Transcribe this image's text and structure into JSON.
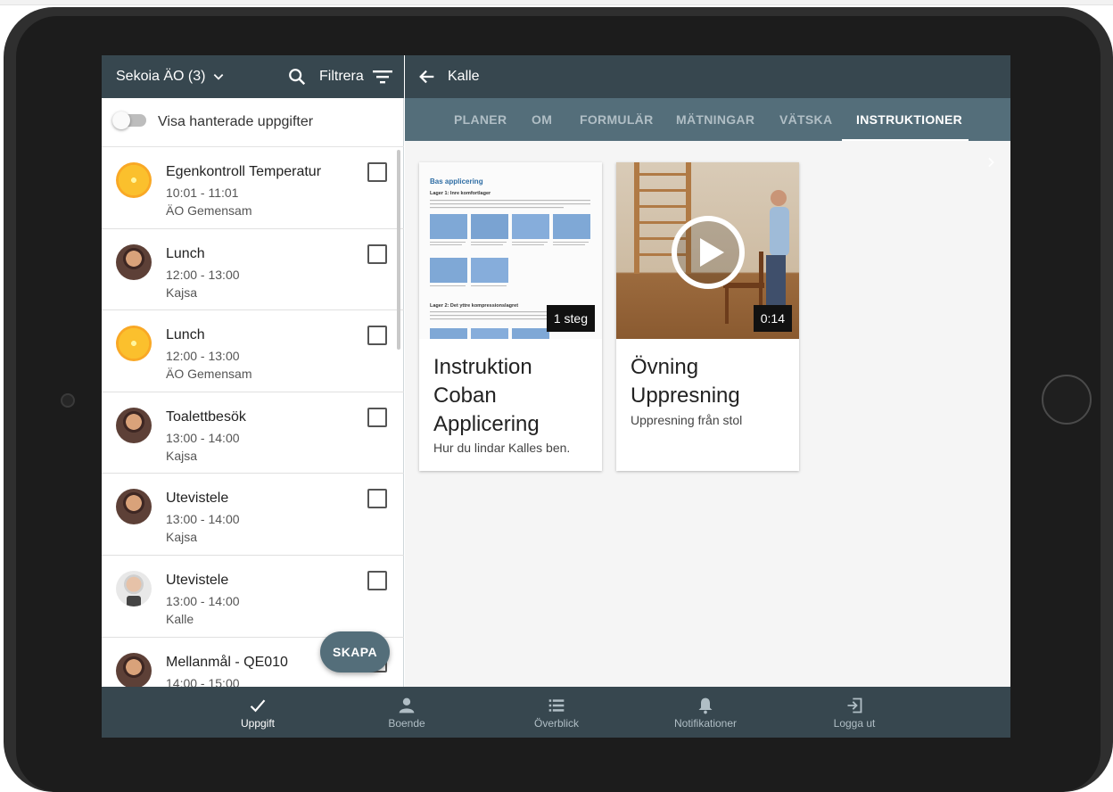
{
  "left_header": {
    "unit": "Sekoia ÄO (3)",
    "filter_label": "Filtrera"
  },
  "toggle": {
    "label": "Visa hanterade uppgifter"
  },
  "tasks": [
    {
      "title": "Egenkontroll Temperatur",
      "time": "10:01 - 11:01",
      "who": "ÄO Gemensam",
      "avatar": "flower-avatar"
    },
    {
      "title": "Lunch",
      "time": "12:00 - 13:00",
      "who": "Kajsa",
      "avatar": "person-avatar"
    },
    {
      "title": "Lunch",
      "time": "12:00 - 13:00",
      "who": "ÄO Gemensam",
      "avatar": "flower-avatar"
    },
    {
      "title": "Toalettbesök",
      "time": "13:00 - 14:00",
      "who": "Kajsa",
      "avatar": "person-avatar"
    },
    {
      "title": "Utevistele",
      "time": "13:00 - 14:00",
      "who": "Kajsa",
      "avatar": "person-avatar"
    },
    {
      "title": "Utevistele",
      "time": "13:00 - 14:00",
      "who": "Kalle",
      "avatar": "person-avatar"
    },
    {
      "title": "Mellanmål - QE010",
      "time": "14:00 - 15:00",
      "who": "",
      "avatar": "person-avatar"
    }
  ],
  "fab": {
    "label": "SKAPA"
  },
  "right_header": {
    "name": "Kalle"
  },
  "tabs": [
    {
      "label": "PLANER",
      "active": false
    },
    {
      "label": "OM",
      "active": false
    },
    {
      "label": "FORMULÄR",
      "active": false
    },
    {
      "label": "MÄTNINGAR",
      "active": false
    },
    {
      "label": "VÄTSKA",
      "active": false
    },
    {
      "label": "INSTRUKTIONER",
      "active": true
    }
  ],
  "cards": [
    {
      "badge": "1 steg",
      "title": "Instruktion Coban Applicering",
      "subtitle": "Hur du lindar Kalles ben.",
      "doc_heading": "Bas applicering",
      "doc_layer1": "Lager 1: Inre komfortlager",
      "doc_layer2": "Lager 2: Det yttre kompressionslagret"
    },
    {
      "badge": "0:14",
      "title": "Övning Uppresning",
      "subtitle": "Uppresning från stol"
    }
  ],
  "bottom_nav": [
    {
      "label": "Uppgift",
      "icon": "check-icon",
      "active": true
    },
    {
      "label": "Boende",
      "icon": "person-icon",
      "active": false
    },
    {
      "label": "Överblick",
      "icon": "list-icon",
      "active": false
    },
    {
      "label": "Notifikationer",
      "icon": "bell-icon",
      "active": false
    },
    {
      "label": "Logga ut",
      "icon": "logout-icon",
      "active": false
    }
  ],
  "colors": {
    "header": "#37474f",
    "tabs": "#546e7a",
    "fab": "#546e7a",
    "content_bg": "#f5f5f5"
  }
}
